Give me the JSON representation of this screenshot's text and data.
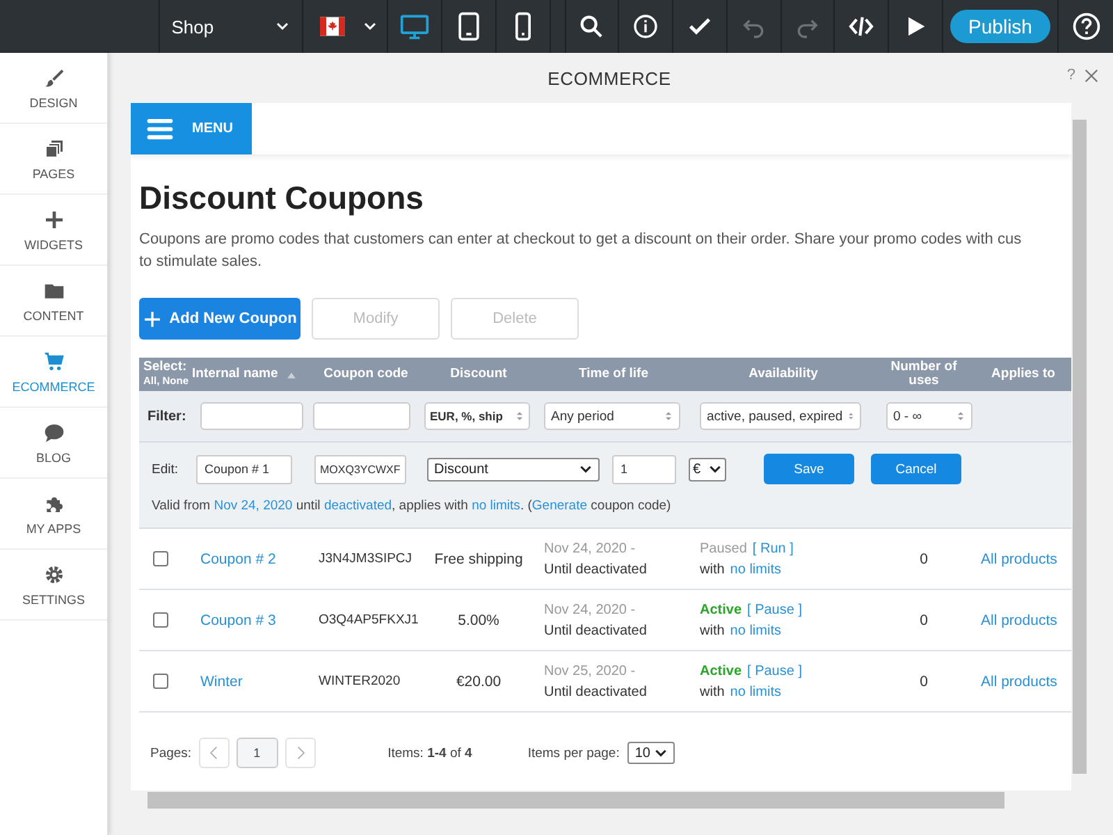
{
  "top_bar": {
    "site_selector": "Shop",
    "devices": [
      {
        "selected": true
      },
      {
        "selected": false
      },
      {
        "selected": false
      }
    ],
    "tools": [
      {
        "disabled": false
      },
      {
        "disabled": false
      },
      {
        "disabled": false
      },
      {
        "disabled": true
      },
      {
        "disabled": true
      },
      {
        "disabled": false
      },
      {
        "disabled": false
      }
    ],
    "publish": "Publish"
  },
  "sidebar": {
    "items": [
      {
        "label": "DESIGN",
        "selected": false
      },
      {
        "label": "PAGES",
        "selected": false
      },
      {
        "label": "WIDGETS",
        "selected": false
      },
      {
        "label": "CONTENT",
        "selected": false
      },
      {
        "label": "ECOMMERCE",
        "selected": true
      },
      {
        "label": "BLOG",
        "selected": false
      },
      {
        "label": "MY APPS",
        "selected": false
      },
      {
        "label": "SETTINGS",
        "selected": false
      }
    ]
  },
  "panel": {
    "title": "ECOMMERCE",
    "help": "?"
  },
  "site_menu": {
    "label": "MENU"
  },
  "page": {
    "title": "Discount Coupons",
    "description_lines": [
      "Coupons are promo codes that customers can enter at checkout to get a discount on their order. Share your promo codes with cus",
      "to stimulate sales."
    ],
    "buttons": [
      {
        "label": "Add New Coupon",
        "kind": "primary",
        "disabled": false
      },
      {
        "label": "Modify",
        "kind": "plain",
        "disabled": true
      },
      {
        "label": "Delete",
        "kind": "plain",
        "disabled": true
      }
    ]
  },
  "table": {
    "select_label": "Select:",
    "select_links": "All, None",
    "columns": [
      {
        "label": "Internal name",
        "sorted": true
      },
      {
        "label": "Coupon code",
        "sorted": false
      },
      {
        "label": "Discount",
        "sorted": false
      },
      {
        "label": "Time of life",
        "sorted": false
      },
      {
        "label": "Availability",
        "sorted": false
      },
      {
        "label": "Number of uses",
        "sorted": false
      },
      {
        "label": "Applies to",
        "sorted": false
      }
    ],
    "filter": {
      "label": "Filter:",
      "fields": [
        {
          "kind": "text"
        },
        {
          "kind": "text"
        },
        {
          "kind": "select",
          "value": "EUR, %, ship"
        },
        {
          "kind": "select",
          "value": "Any period"
        },
        {
          "kind": "select",
          "value": "active, paused, expired"
        },
        {
          "kind": "select",
          "value": "0 - ∞"
        }
      ]
    },
    "edit": {
      "label": "Edit:",
      "name": "Coupon # 1",
      "code": "MOXQ3YCWXF",
      "type": "Discount",
      "amount": "1",
      "currency": "€",
      "save": "Save",
      "cancel": "Cancel",
      "validity": [
        {
          "text": "Valid from ",
          "link": false
        },
        {
          "text": "Nov 24, 2020",
          "link": true
        },
        {
          "text": " until ",
          "link": false
        },
        {
          "text": "deactivated",
          "link": true
        },
        {
          "text": ", applies with ",
          "link": false
        },
        {
          "text": "no limits",
          "link": true
        },
        {
          "text": ". (",
          "link": false
        },
        {
          "text": "Generate",
          "link": true
        },
        {
          "text": " coupon code)",
          "link": false
        }
      ]
    },
    "rows": [
      {
        "checked": false,
        "name": "Coupon # 2",
        "code": "J3N4JM3SIPCJ",
        "discount": "Free shipping",
        "start": "Nov 24, 2020 -",
        "end": "Until deactivated",
        "status": "Paused",
        "active": false,
        "action": "[ Run ]",
        "limit_prefix": "with",
        "limit": "no limits",
        "uses": "0",
        "applies": "All products"
      },
      {
        "checked": false,
        "name": "Coupon # 3",
        "code": "O3Q4AP5FKXJ1",
        "discount": "5.00%",
        "start": "Nov 24, 2020 -",
        "end": "Until deactivated",
        "status": "Active",
        "active": true,
        "action": "[ Pause ]",
        "limit_prefix": "with",
        "limit": "no limits",
        "uses": "0",
        "applies": "All products"
      },
      {
        "checked": false,
        "name": "Winter",
        "code": "WINTER2020",
        "discount": "€20.00",
        "start": "Nov 25, 2020 -",
        "end": "Until deactivated",
        "status": "Active",
        "active": true,
        "action": "[ Pause ]",
        "limit_prefix": "with",
        "limit": "no limits",
        "uses": "0",
        "applies": "All products"
      }
    ],
    "pagination": {
      "label": "Pages:",
      "page": "1",
      "items": "Items: **1-4** of **4**",
      "per_page_label": "Items per page:",
      "per_page": "10"
    }
  }
}
